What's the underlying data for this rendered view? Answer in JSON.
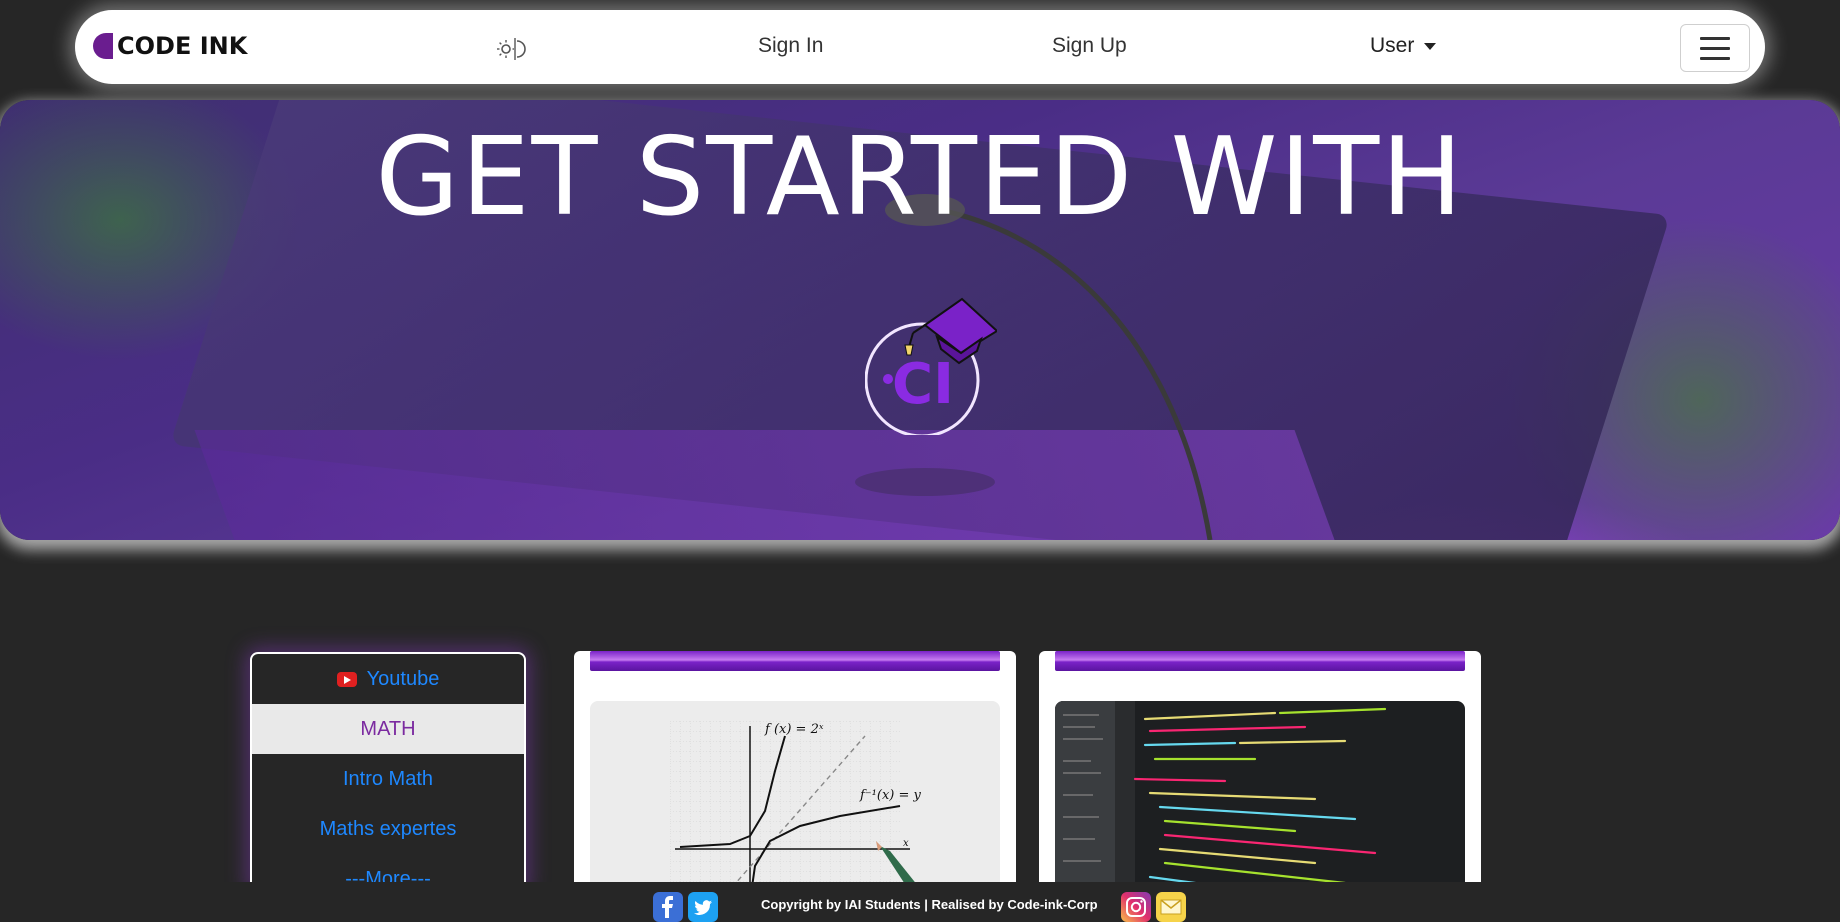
{
  "nav": {
    "brand": "CODE INK",
    "sign_in": "Sign In",
    "sign_up": "Sign Up",
    "user": "User",
    "theme_toggle_icon": "sun-moon-icon",
    "menu_icon": "hamburger-icon"
  },
  "hero": {
    "title": "GET STARTED WITH",
    "logo_text": "CI",
    "accent_color": "#7b2aa0"
  },
  "side_menu": {
    "items": [
      {
        "label": "Youtube",
        "icon": "youtube-icon"
      },
      {
        "label": "MATH",
        "active": true
      },
      {
        "label": "Intro Math"
      },
      {
        "label": "Maths expertes"
      },
      {
        "label": "---More---"
      }
    ]
  },
  "cards": [
    {
      "name": "math-course-card",
      "image": "math-graph-image",
      "labels": {
        "f": "f (x) = 2ˣ",
        "finv": "f⁻¹(x) = y",
        "x": "x"
      }
    },
    {
      "name": "code-course-card",
      "image": "code-editor-image"
    }
  ],
  "footer": {
    "copyright": "Copyright by IAI Students | Realised by Code-ink-Corp",
    "icons": [
      "facebook-icon",
      "twitter-icon",
      "instagram-icon",
      "mail-icon"
    ]
  }
}
